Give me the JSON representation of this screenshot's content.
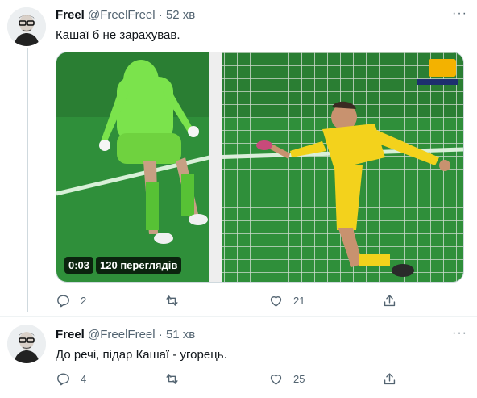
{
  "tweets": [
    {
      "name": "Freel",
      "handle": "@FreelFreel",
      "separator": "·",
      "time": "52 хв",
      "text": "Кашаї б не зарахував.",
      "video": {
        "duration": "0:03",
        "views": "120 переглядів"
      },
      "actions": {
        "reply": "2",
        "retweet": "",
        "like": "21",
        "share": ""
      }
    },
    {
      "name": "Freel",
      "handle": "@FreelFreel",
      "separator": "·",
      "time": "51 хв",
      "text": "До речі, підар Кашаї - угорець.",
      "actions": {
        "reply": "4",
        "retweet": "",
        "like": "25",
        "share": ""
      }
    }
  ],
  "more_label": "···",
  "icons": [
    "reply-icon",
    "retweet-icon",
    "like-icon",
    "share-icon",
    "more-icon"
  ],
  "colors": {
    "text": "#0f1419",
    "secondary": "#536471",
    "border": "#cfd9de",
    "pitch": "#2f8f3a",
    "goalkeeper": "#7be34c",
    "player": "#f3d21c"
  }
}
